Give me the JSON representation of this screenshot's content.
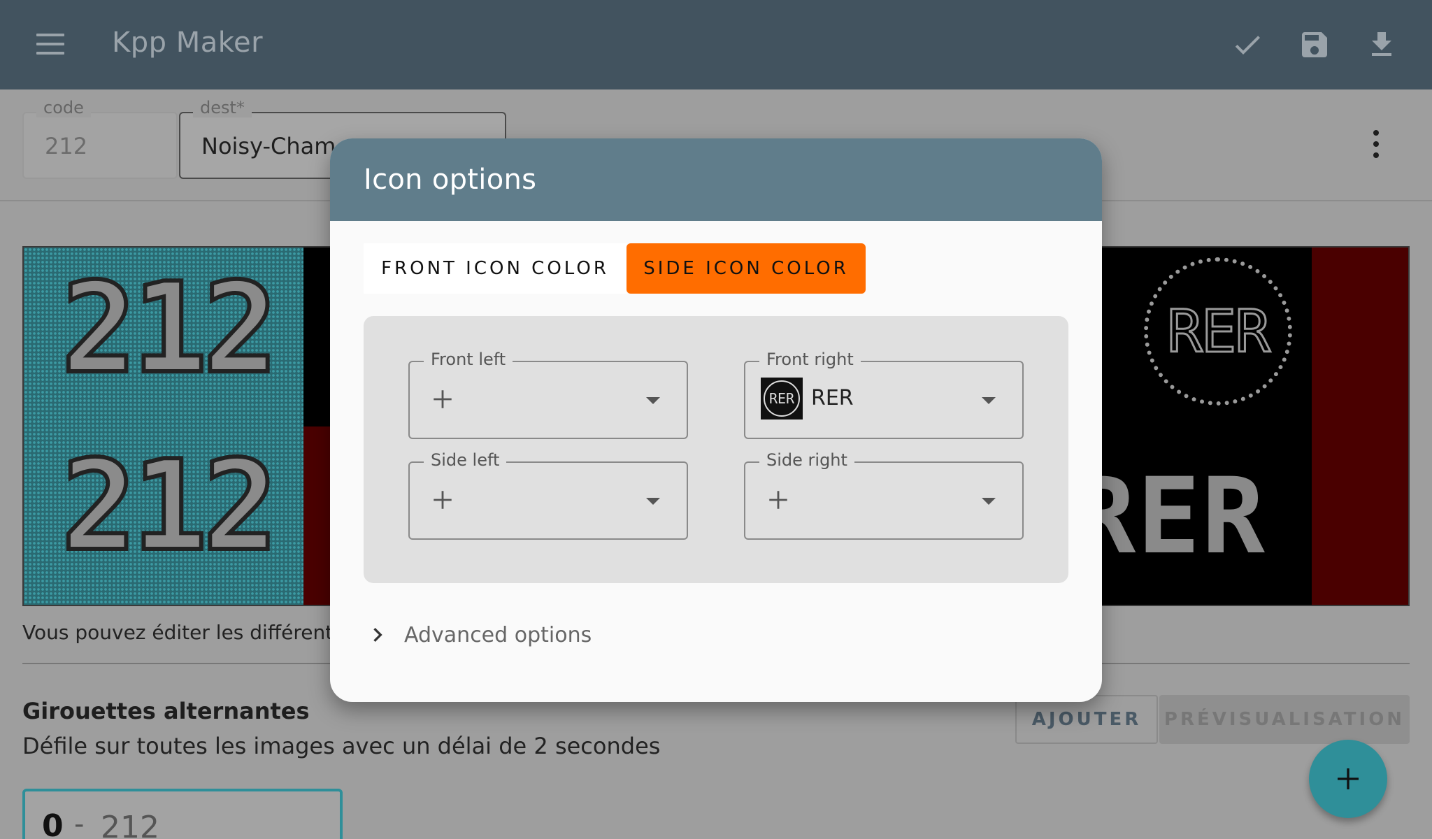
{
  "appbar": {
    "title": "Kpp Maker",
    "icons": [
      "menu-icon",
      "check-icon",
      "save-icon",
      "download-icon"
    ]
  },
  "form": {
    "code": {
      "label": "code",
      "value": "212"
    },
    "dest": {
      "label": "dest*",
      "value": "Noisy-Cham"
    }
  },
  "preview": {
    "front_number": "212",
    "side_number": "212",
    "icon_text": "RER",
    "side_text": "RER"
  },
  "hint": "Vous pouvez éditer les différentes",
  "alternating": {
    "title": "Girouettes alternantes",
    "subtitle": "Défile sur toutes les images avec un délai de 2 secondes",
    "add_label": "AJOUTER",
    "preview_label": "PRÉVISUALISATION",
    "item": {
      "index": "0",
      "separator": "-",
      "name": "212"
    }
  },
  "dialog": {
    "title": "Icon options",
    "tabs": {
      "front": "FRONT ICON COLOR",
      "side": "SIDE ICON COLOR",
      "active": "side"
    },
    "selects": {
      "front_left": {
        "label": "Front left",
        "value": ""
      },
      "front_right": {
        "label": "Front right",
        "value": "RER",
        "icon_text": "RER"
      },
      "side_left": {
        "label": "Side left",
        "value": ""
      },
      "side_right": {
        "label": "Side right",
        "value": ""
      }
    },
    "advanced_label": "Advanced options"
  },
  "colors": {
    "appbar": "#42535f",
    "dialog_header": "#607d8b",
    "active_tab": "#ff6d00",
    "fab": "#2f8f99"
  }
}
